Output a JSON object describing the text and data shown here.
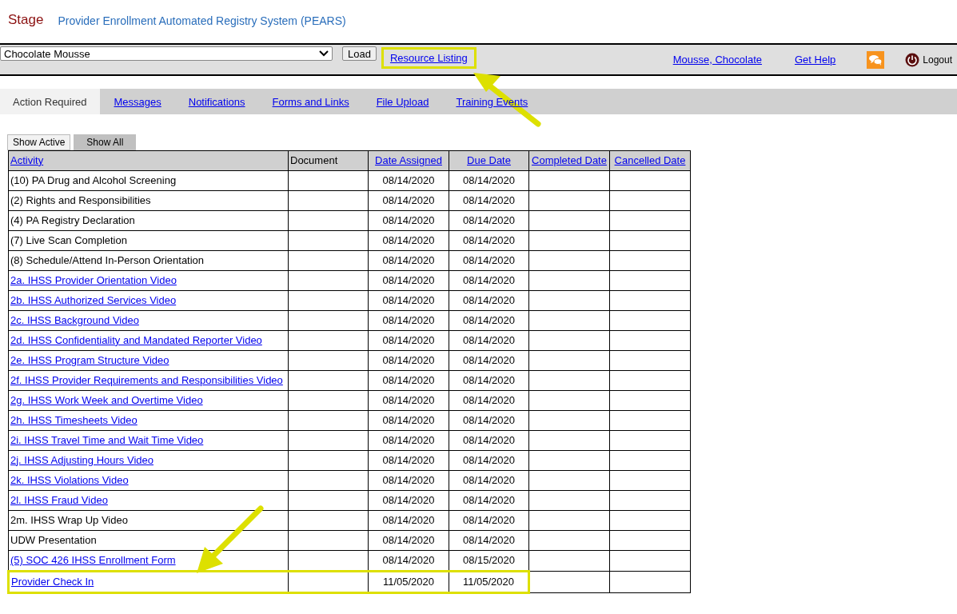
{
  "header": {
    "environment": "Stage",
    "title": "Provider Enrollment Automated Registry System (PEARS)"
  },
  "toolbar": {
    "select_value": "Chocolate Mousse",
    "load_button": "Load",
    "resource_link": {
      "label": "Resource Listing",
      "highlighted": true
    },
    "user_link": "Mousse, Chocolate",
    "help_link": "Get Help",
    "logout": "Logout"
  },
  "tabs": [
    {
      "label": "Action Required",
      "selected": true
    },
    {
      "label": "Messages",
      "selected": false
    },
    {
      "label": "Notifications",
      "selected": false
    },
    {
      "label": "Forms and Links",
      "selected": false
    },
    {
      "label": "File Upload",
      "selected": false
    },
    {
      "label": "Training Events",
      "selected": false
    }
  ],
  "filters": [
    {
      "label": "Show Active",
      "selected": true
    },
    {
      "label": "Show All",
      "selected": false
    }
  ],
  "table": {
    "columns": [
      {
        "label": "Activity",
        "sortable": true
      },
      {
        "label": "Document",
        "sortable": false
      },
      {
        "label": "Date Assigned",
        "sortable": true
      },
      {
        "label": "Due Date",
        "sortable": true
      },
      {
        "label": "Completed Date",
        "sortable": true
      },
      {
        "label": "Cancelled Date",
        "sortable": true
      }
    ],
    "rows": [
      {
        "activity": "(10) PA Drug and Alcohol Screening",
        "link": false,
        "assigned": "08/14/2020",
        "due": "08/14/2020",
        "highlighted": false
      },
      {
        "activity": "(2) Rights and Responsibilities",
        "link": false,
        "assigned": "08/14/2020",
        "due": "08/14/2020",
        "highlighted": false
      },
      {
        "activity": "(4) PA Registry Declaration",
        "link": false,
        "assigned": "08/14/2020",
        "due": "08/14/2020",
        "highlighted": false
      },
      {
        "activity": "(7) Live Scan Completion",
        "link": false,
        "assigned": "08/14/2020",
        "due": "08/14/2020",
        "highlighted": false
      },
      {
        "activity": "(8) Schedule/Attend In-Person Orientation",
        "link": false,
        "assigned": "08/14/2020",
        "due": "08/14/2020",
        "highlighted": false
      },
      {
        "activity": "2a. IHSS Provider Orientation Video",
        "link": true,
        "assigned": "08/14/2020",
        "due": "08/14/2020",
        "highlighted": false
      },
      {
        "activity": "2b. IHSS Authorized Services Video",
        "link": true,
        "assigned": "08/14/2020",
        "due": "08/14/2020",
        "highlighted": false
      },
      {
        "activity": "2c. IHSS Background Video",
        "link": true,
        "assigned": "08/14/2020",
        "due": "08/14/2020",
        "highlighted": false
      },
      {
        "activity": "2d. IHSS Confidentiality and Mandated Reporter Video",
        "link": true,
        "assigned": "08/14/2020",
        "due": "08/14/2020",
        "highlighted": false
      },
      {
        "activity": "2e. IHSS Program Structure Video",
        "link": true,
        "assigned": "08/14/2020",
        "due": "08/14/2020",
        "highlighted": false
      },
      {
        "activity": "2f. IHSS Provider Requirements and Responsibilities Video",
        "link": true,
        "assigned": "08/14/2020",
        "due": "08/14/2020",
        "highlighted": false
      },
      {
        "activity": "2g. IHSS Work Week and Overtime Video",
        "link": true,
        "assigned": "08/14/2020",
        "due": "08/14/2020",
        "highlighted": false
      },
      {
        "activity": "2h. IHSS Timesheets Video",
        "link": true,
        "assigned": "08/14/2020",
        "due": "08/14/2020",
        "highlighted": false
      },
      {
        "activity": "2i. IHSS Travel Time and Wait Time Video",
        "link": true,
        "assigned": "08/14/2020",
        "due": "08/14/2020",
        "highlighted": false
      },
      {
        "activity": "2j. IHSS Adjusting Hours Video",
        "link": true,
        "assigned": "08/14/2020",
        "due": "08/14/2020",
        "highlighted": false
      },
      {
        "activity": "2k. IHSS Violations Video",
        "link": true,
        "assigned": "08/14/2020",
        "due": "08/14/2020",
        "highlighted": false
      },
      {
        "activity": "2l. IHSS Fraud Video",
        "link": true,
        "assigned": "08/14/2020",
        "due": "08/14/2020",
        "highlighted": false
      },
      {
        "activity": "2m. IHSS Wrap Up Video",
        "link": false,
        "assigned": "08/14/2020",
        "due": "08/14/2020",
        "highlighted": false
      },
      {
        "activity": "UDW Presentation",
        "link": false,
        "assigned": "08/14/2020",
        "due": "08/14/2020",
        "highlighted": false
      },
      {
        "activity": "(5) SOC 426 IHSS Enrollment Form",
        "link": true,
        "assigned": "08/14/2020",
        "due": "08/15/2020",
        "highlighted": false
      },
      {
        "activity": "Provider Check In",
        "link": true,
        "assigned": "11/05/2020",
        "due": "11/05/2020",
        "highlighted": true
      }
    ]
  }
}
